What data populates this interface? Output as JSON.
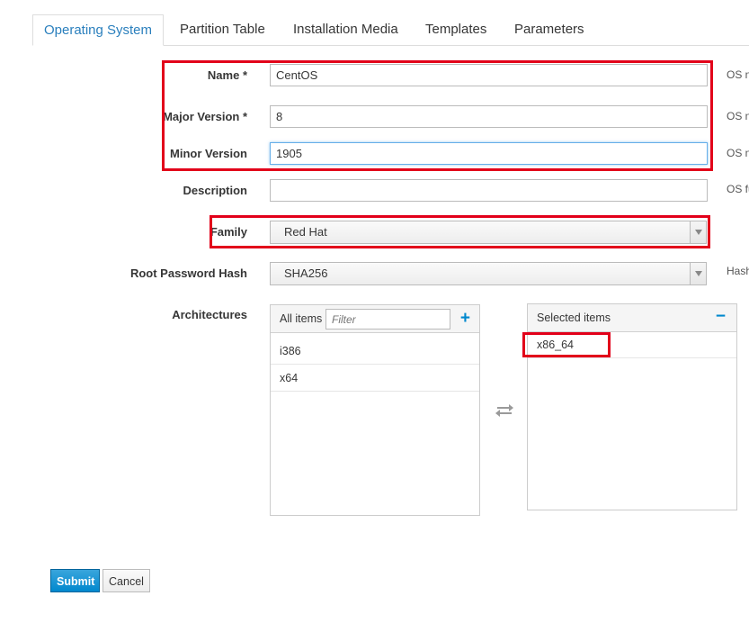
{
  "tabs": [
    {
      "label": "Operating System",
      "active": true
    },
    {
      "label": "Partition Table"
    },
    {
      "label": "Installation Media"
    },
    {
      "label": "Templates"
    },
    {
      "label": "Parameters"
    }
  ],
  "form": {
    "name": {
      "label": "Name *",
      "value": "CentOS",
      "help": "OS n"
    },
    "major": {
      "label": "Major Version *",
      "value": "8",
      "help": "OS n"
    },
    "minor": {
      "label": "Minor Version",
      "value": "1905",
      "help": "OS n"
    },
    "description": {
      "label": "Description",
      "value": "",
      "help": "OS fu"
    },
    "family": {
      "label": "Family",
      "value": "Red Hat"
    },
    "hash": {
      "label": "Root Password Hash",
      "value": "SHA256",
      "help": "Hash"
    },
    "architectures": {
      "label": "Architectures",
      "all_title": "All items",
      "filter_placeholder": "Filter",
      "plus_icon": "+",
      "available": [
        "i386",
        "x64"
      ],
      "selected_title": "Selected items",
      "minus_icon": "−",
      "selected": [
        "x86_64"
      ]
    }
  },
  "buttons": {
    "submit": "Submit",
    "cancel": "Cancel"
  },
  "colors": {
    "accent": "#0088ce",
    "annotation": "#e2001a",
    "active_tab": "#2a7fbd"
  }
}
